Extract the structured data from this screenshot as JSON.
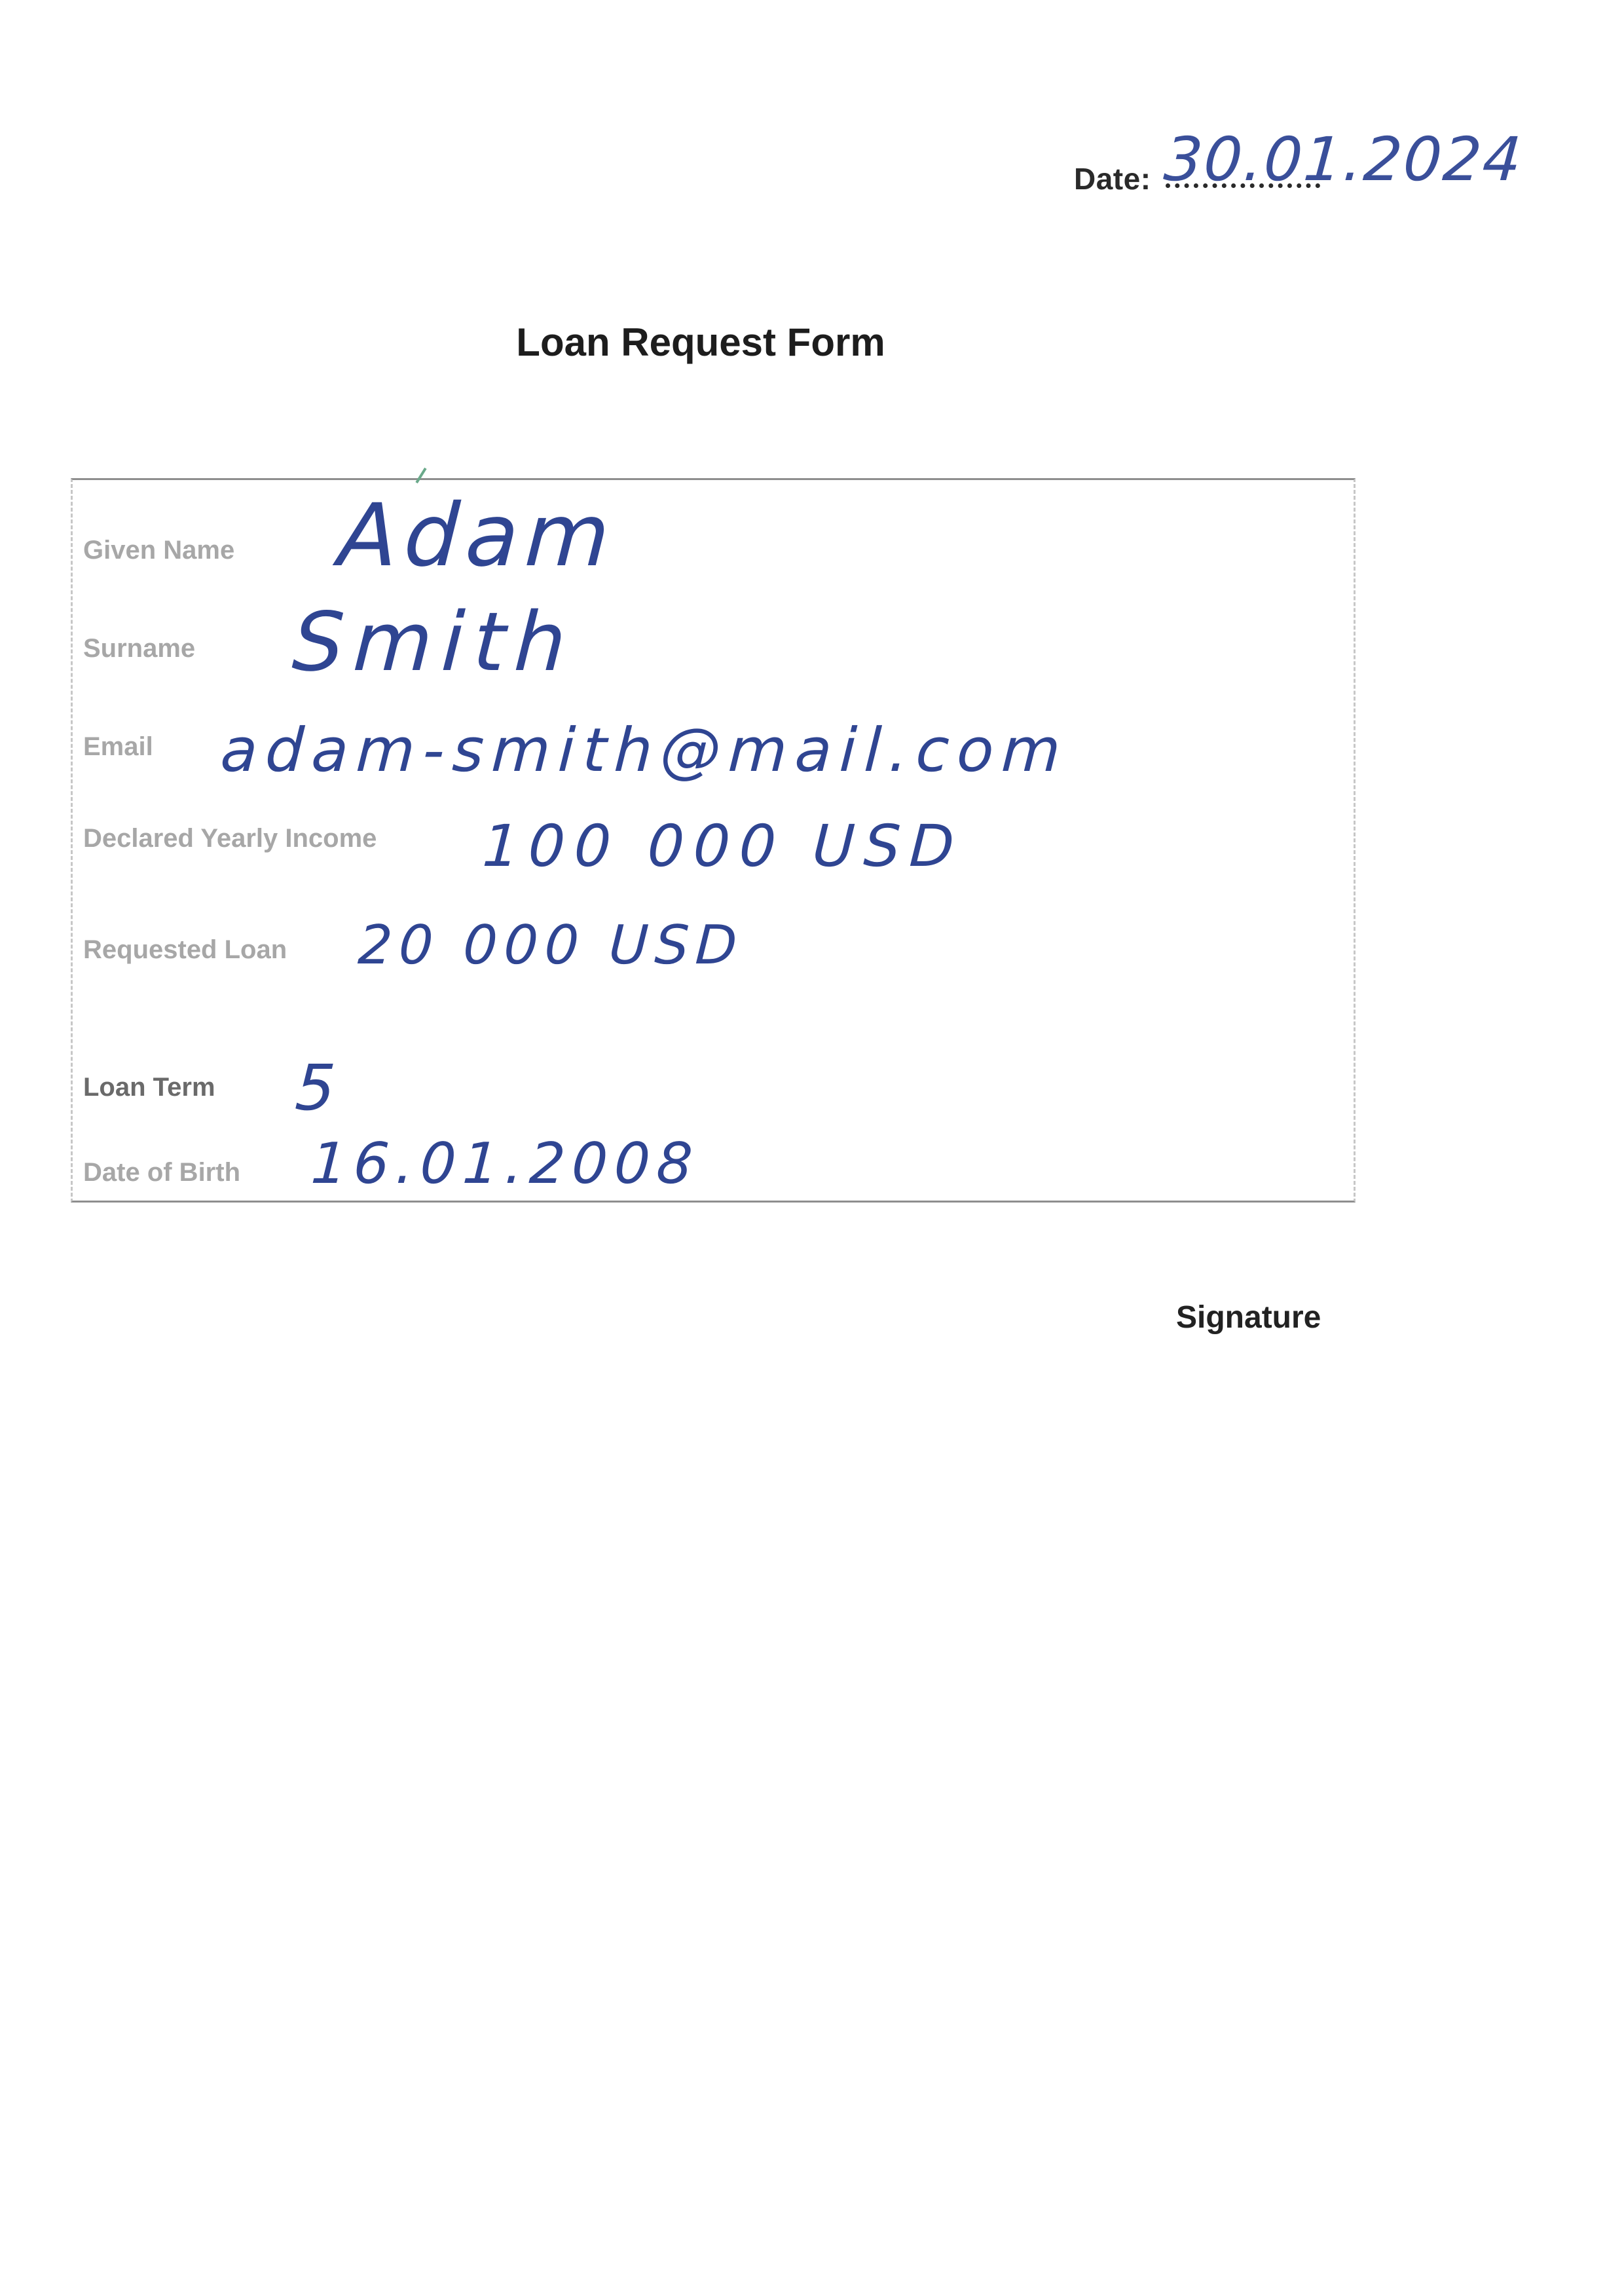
{
  "header": {
    "date_label": "Date:",
    "date_value": "30.01.2024"
  },
  "title": "Loan Request Form",
  "form": {
    "fields": [
      {
        "label": "Given Name",
        "value": "Adam"
      },
      {
        "label": "Surname",
        "value": "Smith"
      },
      {
        "label": "Email",
        "value": "adam-smith@mail.com"
      },
      {
        "label": "Declared Yearly Income",
        "value": "100 000 USD"
      },
      {
        "label": "Requested Loan",
        "value": "20 000 USD"
      },
      {
        "label": "Loan Term",
        "value": "5"
      },
      {
        "label": "Date of Birth",
        "value": "16.01.2008"
      }
    ]
  },
  "footer": {
    "signature_label": "Signature"
  },
  "colors": {
    "ink": "#2f4592",
    "printed_text": "#1f1f1f",
    "faded_label": "#a7a7a7"
  }
}
